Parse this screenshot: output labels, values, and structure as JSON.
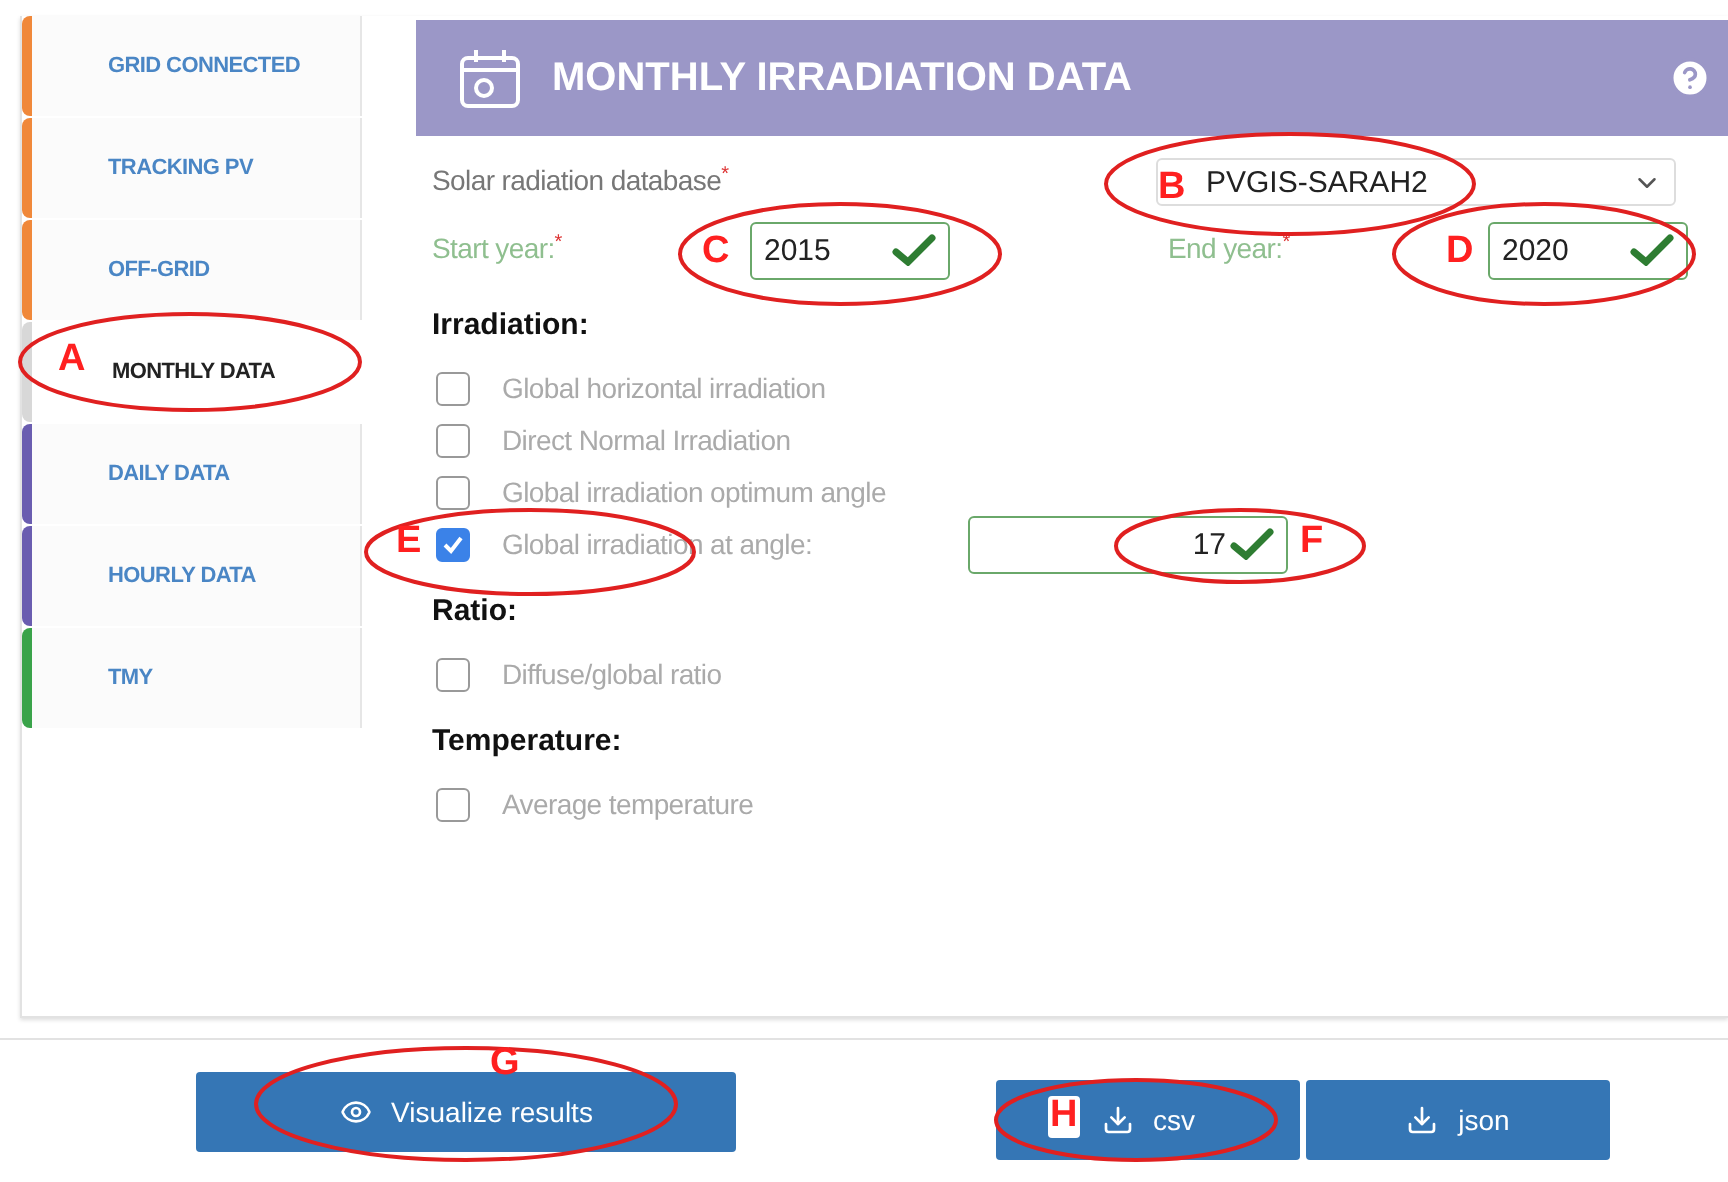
{
  "sidebar": {
    "items": [
      {
        "label": "GRID CONNECTED",
        "color": "#f0883a",
        "selected": false
      },
      {
        "label": "TRACKING PV",
        "color": "#f0883a",
        "selected": false
      },
      {
        "label": "OFF-GRID",
        "color": "#f0883a",
        "selected": false
      },
      {
        "label": "MONTHLY DATA",
        "color": "#d8d8d8",
        "selected": true
      },
      {
        "label": "DAILY DATA",
        "color": "#6a5db0",
        "selected": false
      },
      {
        "label": "HOURLY DATA",
        "color": "#6a5db0",
        "selected": false
      },
      {
        "label": "TMY",
        "color": "#3aa34a",
        "selected": false
      }
    ]
  },
  "header": {
    "title": "MONTHLY IRRADIATION DATA"
  },
  "database": {
    "label": "Solar radiation database",
    "required_mark": "*",
    "value": "PVGIS-SARAH2"
  },
  "start_year": {
    "label": "Start year:",
    "required_mark": "*",
    "value": "2015",
    "valid": true
  },
  "end_year": {
    "label": "End year:",
    "required_mark": "*",
    "value": "2020",
    "valid": true
  },
  "sections": [
    {
      "heading": "Irradiation:",
      "options": [
        {
          "label": "Global horizontal irradiation",
          "checked": false
        },
        {
          "label": "Direct Normal Irradiation",
          "checked": false
        },
        {
          "label": "Global irradiation optimum angle",
          "checked": false
        },
        {
          "label": "Global irradiation at angle:",
          "checked": true,
          "input": {
            "value": "17",
            "valid": true
          }
        }
      ]
    },
    {
      "heading": "Ratio:",
      "options": [
        {
          "label": "Diffuse/global ratio",
          "checked": false
        }
      ]
    },
    {
      "heading": "Temperature:",
      "options": [
        {
          "label": "Average temperature",
          "checked": false
        }
      ]
    }
  ],
  "buttons": [
    {
      "label": "Visualize results",
      "kind": "view"
    },
    {
      "label": "csv",
      "kind": "download"
    },
    {
      "label": "json",
      "kind": "download"
    }
  ],
  "annotations": [
    "A",
    "B",
    "C",
    "D",
    "E",
    "F",
    "G",
    "H"
  ]
}
